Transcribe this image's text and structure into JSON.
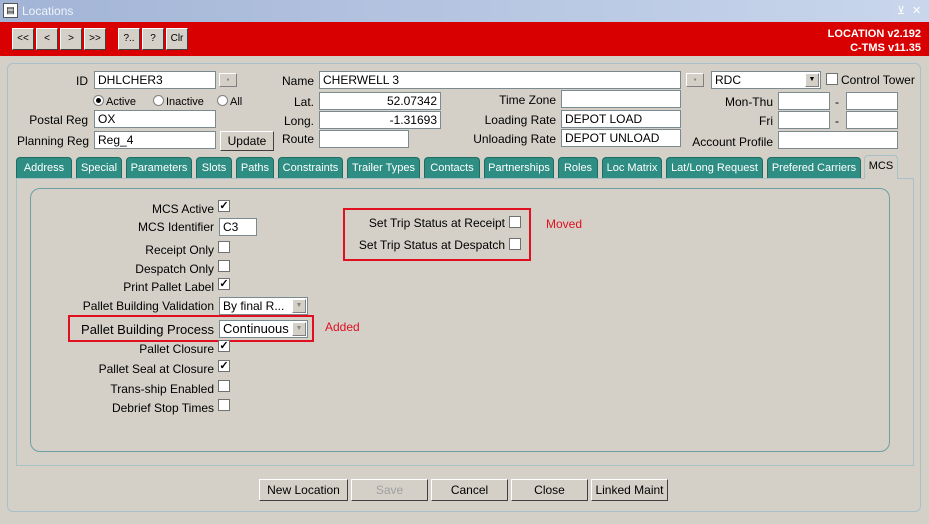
{
  "window": {
    "title": "Locations",
    "app_icon": "form-icon",
    "controls": [
      "⊻",
      "✕"
    ]
  },
  "toolbar": {
    "nav_buttons": [
      "<<",
      "<",
      ">",
      ">>"
    ],
    "query_buttons": [
      "?..",
      "?",
      "Clr"
    ],
    "version_line1": "LOCATION v2.192",
    "version_line2": "C-TMS v11.35",
    "bg_color": "#d80000"
  },
  "header": {
    "id_label": "ID",
    "id_value": "DHLCHER3",
    "name_label": "Name",
    "name_value": "CHERWELL 3",
    "type_value": "RDC",
    "control_tower_label": "Control Tower",
    "status_options": [
      "Active",
      "Inactive",
      "All"
    ],
    "status_selected": "Active",
    "postal_reg_label": "Postal Reg",
    "postal_reg_value": "OX",
    "planning_reg_label": "Planning Reg",
    "planning_reg_value": "Reg_4",
    "update_label": "Update",
    "lat_label": "Lat.",
    "lat_value": "52.07342",
    "long_label": "Long.",
    "long_value": "-1.31693",
    "route_label": "Route",
    "route_value": "",
    "timezone_label": "Time Zone",
    "timezone_value": "",
    "loading_rate_label": "Loading Rate",
    "loading_rate_value": "DEPOT LOAD",
    "unloading_rate_label": "Unloading Rate",
    "unloading_rate_value": "DEPOT UNLOAD",
    "mon_thu_label": "Mon-Thu",
    "fri_label": "Fri",
    "account_profile_label": "Account Profile",
    "account_profile_value": "",
    "dash": "-"
  },
  "tabs": [
    "Address",
    "Special",
    "Parameters",
    "Slots",
    "Paths",
    "Constraints",
    "Trailer Types",
    "Contacts",
    "Partnerships",
    "Roles",
    "Loc Matrix",
    "Lat/Long Request",
    "Prefered Carriers",
    "MCS"
  ],
  "active_tab": "MCS",
  "mcs": {
    "mcs_active_label": "MCS Active",
    "mcs_active": true,
    "mcs_identifier_label": "MCS Identifier",
    "mcs_identifier_value": "C3",
    "receipt_only_label": "Receipt Only",
    "receipt_only": false,
    "despatch_only_label": "Despatch Only",
    "despatch_only": false,
    "print_pallet_label_label": "Print Pallet Label",
    "print_pallet_label": true,
    "pallet_building_validation_label": "Pallet Building Validation",
    "pallet_building_validation_value": "By final R...",
    "pallet_building_process_label": "Pallet Building Process",
    "pallet_building_process_value": "Continuous",
    "pallet_closure_label": "Pallet Closure",
    "pallet_closure": true,
    "pallet_seal_label": "Pallet Seal at Closure",
    "pallet_seal": true,
    "trans_ship_label": "Trans-ship Enabled",
    "trans_ship": false,
    "debrief_label": "Debrief Stop Times",
    "debrief": false,
    "trip_status_receipt_label": "Set Trip Status at Receipt",
    "trip_status_receipt": false,
    "trip_status_despatch_label": "Set Trip Status at Despatch",
    "trip_status_despatch": false,
    "annotation_moved": "Moved",
    "annotation_added": "Added",
    "annotation_color": "#e01020"
  },
  "footer": {
    "new_location": "New Location",
    "save": "Save",
    "cancel": "Cancel",
    "close": "Close",
    "linked_maint": "Linked Maint"
  }
}
